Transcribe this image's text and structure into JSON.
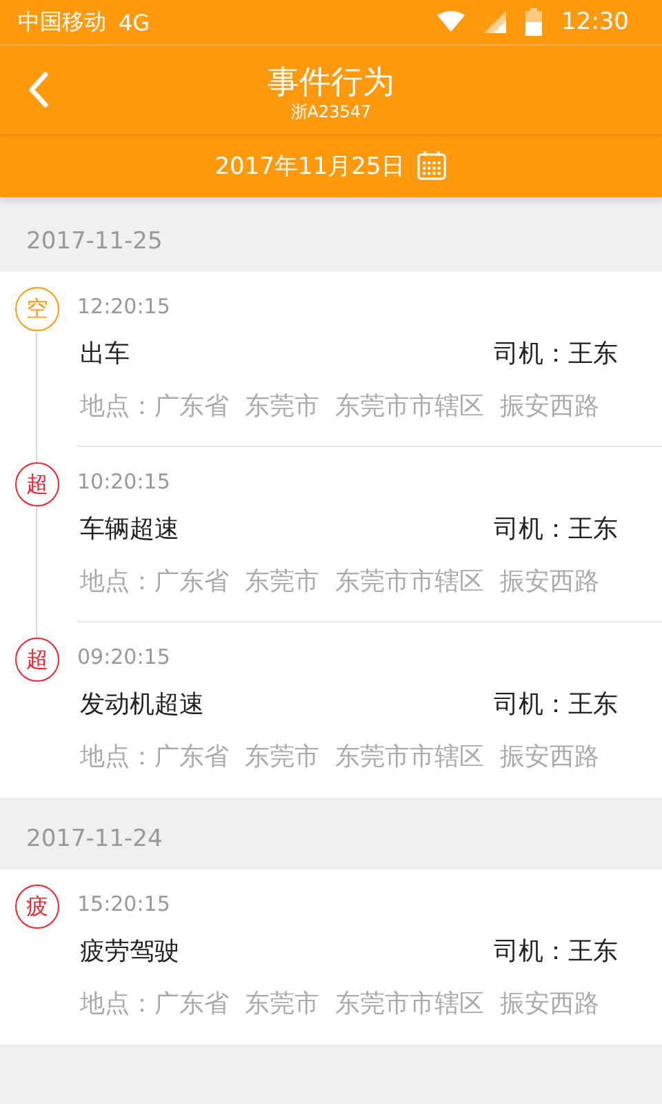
{
  "status_bar": {
    "carrier": "中国移动",
    "network": "4G",
    "time": "12:30"
  },
  "header": {
    "title": "事件行为",
    "subtitle": "浙A23547"
  },
  "date_bar": {
    "date": "2017年11月25日"
  },
  "groups": [
    {
      "date": "2017-11-25",
      "events": [
        {
          "badge": "空",
          "color": "#ff9a0f",
          "time": "12:20:15",
          "title": "出车",
          "driver": "司机：王东",
          "address": "地点：广东省  东莞市  东莞市市辖区  振安西路"
        },
        {
          "badge": "超",
          "color": "#f5222d",
          "time": "10:20:15",
          "title": "车辆超速",
          "driver": "司机：王东",
          "address": "地点：广东省  东莞市  东莞市市辖区  振安西路"
        },
        {
          "badge": "超",
          "color": "#f5222d",
          "time": "09:20:15",
          "title": "发动机超速",
          "driver": "司机：王东",
          "address": "地点：广东省  东莞市  东莞市市辖区  振安西路"
        }
      ]
    },
    {
      "date": "2017-11-24",
      "events": [
        {
          "badge": "疲",
          "color": "#f5222d",
          "time": "15:20:15",
          "title": "疲劳驾驶",
          "driver": "司机：王东",
          "address": "地点：广东省  东莞市  东莞市市辖区  振安西路"
        }
      ]
    }
  ]
}
